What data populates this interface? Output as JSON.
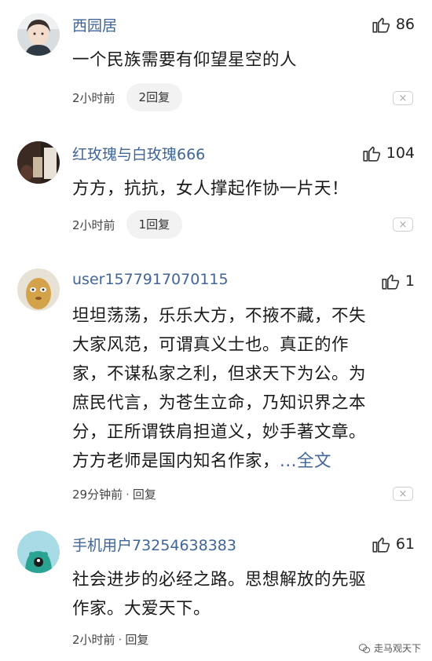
{
  "comments": [
    {
      "username": "西园居",
      "likes": "86",
      "lines": [
        "一个民族需要有仰望星空的人"
      ],
      "time": "2小时前",
      "reply": "2回复",
      "avatar": "woman-portrait-avatar"
    },
    {
      "username": "红玫瑰与白玫瑰666",
      "likes": "104",
      "lines": [
        "方方，抗抗，女人撑起作协一片天！"
      ],
      "time": "2小时前",
      "reply": "1回复",
      "avatar": "dark-photo-avatar"
    },
    {
      "username": "user1577917070115",
      "likes": "1",
      "lines": [
        "坦坦荡荡，乐乐大方，不掖不藏，不失",
        "大家风范，可谓真义士也。真正的作",
        "家，不谋私家之利，但求天下为公。为",
        "庶民代言，为苍生立命，乃知识界之本",
        "分，正所谓铁肩担道义，妙手著文章。"
      ],
      "last_line": "方方老师是国内知名作家，",
      "more": "...全文",
      "time": "29分钟前",
      "reply": "回复",
      "avatar": "potato-cartoon-avatar"
    },
    {
      "username": "手机用户73254638383",
      "likes": "61",
      "lines": [
        "社会进步的必经之路。思想解放的先驱",
        "作家。大爱天下。"
      ],
      "time": "2小时前",
      "reply": "回复",
      "avatar": "teal-creature-avatar"
    }
  ],
  "close_symbol": "×",
  "dot": "·",
  "watermark": "走马观天下",
  "colors": {
    "username": "#406599",
    "link": "#406599",
    "text": "#1a1a1a"
  }
}
